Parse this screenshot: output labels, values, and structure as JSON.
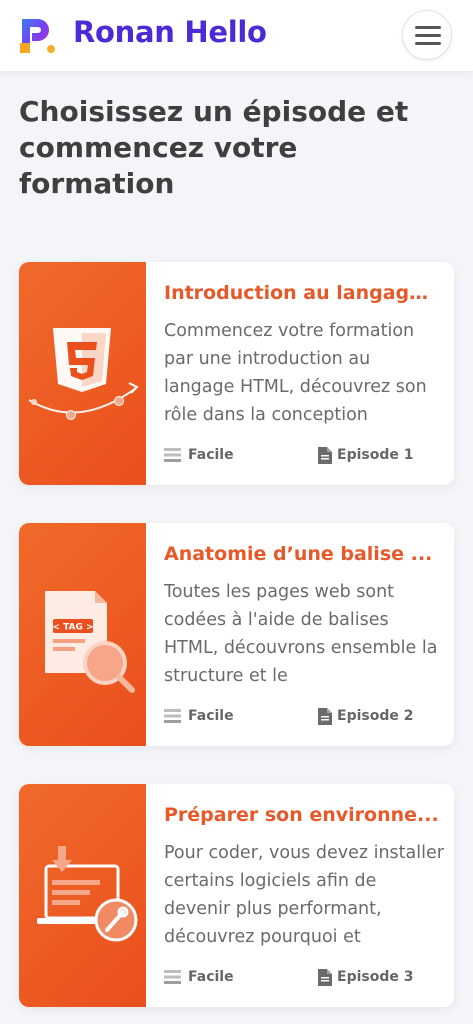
{
  "header": {
    "brand": "Ronan Hello",
    "logo_icon": "logo-r-icon",
    "menu_icon": "hamburger-menu-icon"
  },
  "page": {
    "title": "Choisissez un épisode et commencez votre formation"
  },
  "colors": {
    "brand": "#4b2bd6",
    "accent": "#e8592a",
    "thumbnail": "#ef6326"
  },
  "episodes": [
    {
      "title": "Introduction au langage...",
      "description": "Commencez votre formation par une introduction au langage HTML, découvrez son rôle dans la conception",
      "level": "Facile",
      "episode": "Episode 1",
      "thumbnail_icon": "html5-icon"
    },
    {
      "title": "Anatomie d’une balise ...",
      "description": "Toutes les pages web sont codées à l'aide de balises HTML, découvrons ensemble la structure et le",
      "level": "Facile",
      "episode": "Episode 2",
      "thumbnail_icon": "tag-document-search-icon"
    },
    {
      "title": "Préparer son environne...",
      "description": "Pour coder, vous devez installer certains logiciels afin de devenir plus performant, découvrez pourquoi et",
      "level": "Facile",
      "episode": "Episode 3",
      "thumbnail_icon": "laptop-download-wrench-icon"
    }
  ]
}
